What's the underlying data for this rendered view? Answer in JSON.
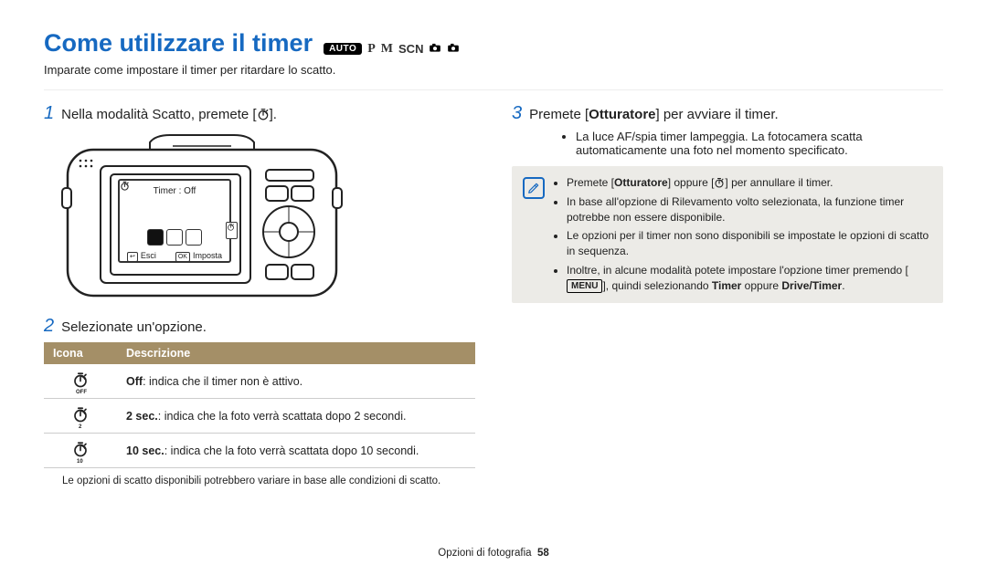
{
  "title": "Come utilizzare il timer",
  "modes": {
    "auto": "AUTO",
    "p": "P",
    "m": "M",
    "scn": "SCN"
  },
  "subtitle": "Imparate come impostare il timer per ritardare lo scatto.",
  "steps": {
    "s1_num": "1",
    "s1_txt": "Nella modalità Scatto, premete [",
    "s1_end": "].",
    "s2_num": "2",
    "s2_txt": "Selezionate un'opzione.",
    "s3_num": "3",
    "s3_pre": "Premete [",
    "s3_bold": "Otturatore",
    "s3_post": "] per avviare il timer."
  },
  "camera_screen": {
    "top": "Timer : Off",
    "esc_key": "↩",
    "esc": "Esci",
    "set_key": "OK",
    "set": "Imposta"
  },
  "table": {
    "h1": "Icona",
    "h2": "Descrizione",
    "rows": [
      {
        "icon_sub": "OFF",
        "b": "Off",
        "rest": ": indica che il timer non è attivo."
      },
      {
        "icon_sub": "2",
        "b": "2 sec.",
        "rest": ": indica che la foto verrà scattata dopo 2 secondi."
      },
      {
        "icon_sub": "10",
        "b": "10 sec.",
        "rest": ": indica che la foto verrà scattata dopo 10 secondi."
      }
    ],
    "foot": "Le opzioni di scatto disponibili potrebbero variare in base alle condizioni di scatto."
  },
  "right_bullets": [
    "La luce AF/spia timer lampeggia. La fotocamera scatta automaticamente una foto nel momento specificato."
  ],
  "note": {
    "items": [
      {
        "pre": "Premete [",
        "b": "Otturatore",
        "mid": "] oppure [",
        "post": "] per annullare il timer."
      },
      {
        "txt": "In base all'opzione di Rilevamento volto selezionata, la funzione timer potrebbe non essere disponibile."
      },
      {
        "txt": "Le opzioni per il timer non sono disponibili se impostate le opzioni di scatto in sequenza."
      },
      {
        "pre": "Inoltre, in alcune modalità potete impostare l'opzione timer premendo [",
        "menu": "MENU",
        "mid2": "], quindi selezionando ",
        "b2": "Timer",
        "or": " oppure ",
        "b3": "Drive/Timer",
        "end": "."
      }
    ]
  },
  "footer": {
    "section": "Opzioni di fotografia",
    "page": "58"
  }
}
